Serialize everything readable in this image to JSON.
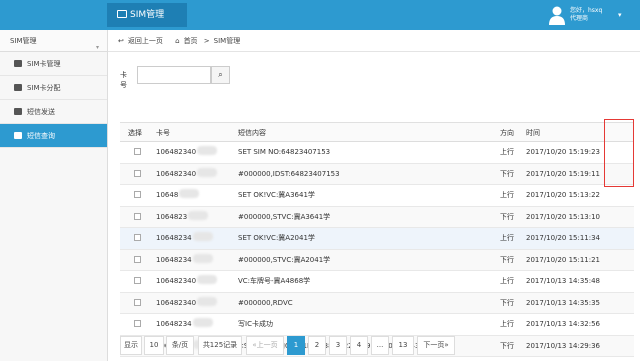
{
  "header": {
    "brand": "SIM管理",
    "user_line1": "您好，hsxq",
    "user_line2": "代理商"
  },
  "sidebar": {
    "title": "SIM管理",
    "items": [
      {
        "label": "SIM卡管理",
        "active": false
      },
      {
        "label": "SIM卡分配",
        "active": false
      },
      {
        "label": "短信发送",
        "active": false
      },
      {
        "label": "短信查询",
        "active": true
      }
    ]
  },
  "breadcrumb": {
    "back": "返回上一页",
    "home": "首页",
    "sep": ">",
    "current": "SIM管理"
  },
  "search": {
    "label": "卡号",
    "value": ""
  },
  "table": {
    "headers": [
      "选择",
      "卡号",
      "短信内容",
      "方向",
      "时间"
    ],
    "rows": [
      {
        "card": "106482340",
        "content": "SET SIM NO:64823407153",
        "dir": "上行",
        "time": "2017/10/20 15:19:23"
      },
      {
        "card": "106482340",
        "content": "#000000,IDST:64823407153",
        "dir": "下行",
        "time": "2017/10/20 15:19:11"
      },
      {
        "card": "10648",
        "content": "SET OK!VC:冀A3641学",
        "dir": "上行",
        "time": "2017/10/20 15:13:22"
      },
      {
        "card": "1064823",
        "content": "#000000,STVC:冀A3641学",
        "dir": "下行",
        "time": "2017/10/20 15:13:10"
      },
      {
        "card": "10648234",
        "content": "SET OK!VC:冀A2041学",
        "dir": "上行",
        "time": "2017/10/20 15:11:34"
      },
      {
        "card": "10648234",
        "content": "#000000,STVC:冀A2041学",
        "dir": "下行",
        "time": "2017/10/20 15:11:21"
      },
      {
        "card": "106482340",
        "content": "VC:车牌号-冀A4868学",
        "dir": "上行",
        "time": "2017/10/13 14:35:48"
      },
      {
        "card": "106482340",
        "content": "#000000,RDVC",
        "dir": "下行",
        "time": "2017/10/13 14:35:35"
      },
      {
        "card": "10648234",
        "content": "写IC卡成功",
        "dir": "上行",
        "time": "2017/10/13 14:32:56"
      },
      {
        "card": "10648234",
        "content": "<SPBSJ*P:BSJGPS*1D:183811,220319197906185435,冯春杰>",
        "dir": "下行",
        "time": "2017/10/13 14:29:36"
      }
    ]
  },
  "pager": {
    "show": "显示",
    "size": "10",
    "per": "条/页",
    "total": "共125记录",
    "prev": "«上一页",
    "pages": [
      "1",
      "2",
      "3",
      "4",
      "...",
      "13"
    ],
    "next": "下一页»"
  }
}
